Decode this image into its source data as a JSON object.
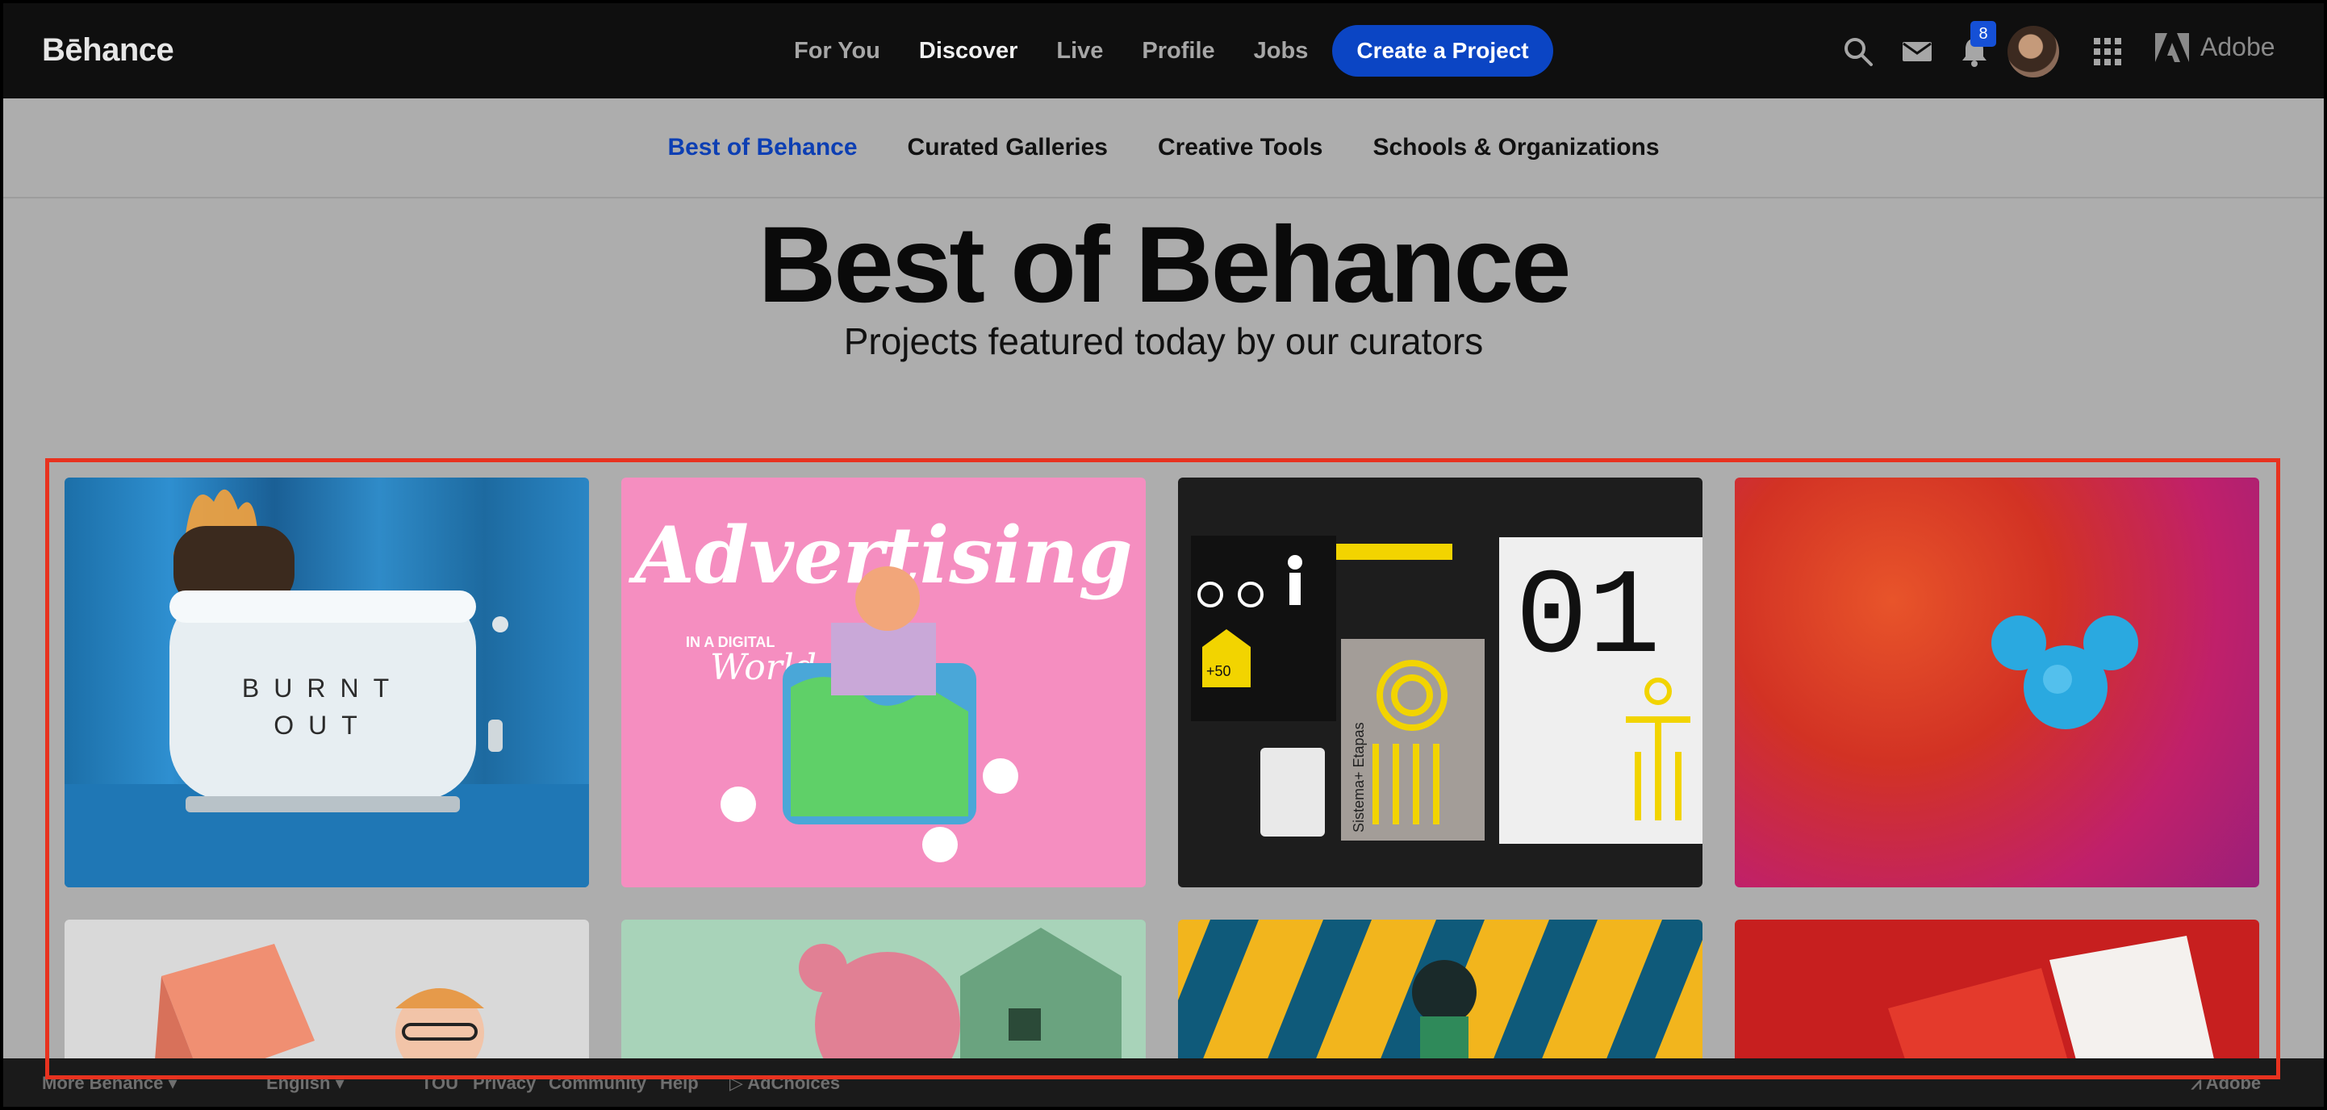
{
  "topnav": {
    "logo": "Bēhance",
    "links": [
      "For You",
      "Discover",
      "Live",
      "Profile",
      "Jobs"
    ],
    "active": "Discover",
    "create_label": "Create a Project",
    "notification_count": "8",
    "adobe_label": "Adobe"
  },
  "subnav": {
    "items": [
      "Best of Behance",
      "Curated Galleries",
      "Creative Tools",
      "Schools & Organizations"
    ],
    "active": "Best of Behance"
  },
  "hero": {
    "title": "Best of Behance",
    "subtitle": "Projects featured today by our curators"
  },
  "cards": {
    "toaster_text_1": "BURNT",
    "toaster_text_2": "OUT",
    "advertising_title": "Advertising",
    "advertising_sub_1": "IN A DIGITAL",
    "advertising_sub_2": "World",
    "etapas_number": "01",
    "etapas_plus": "+50",
    "etapas_vertical": "Sistema+ Etapas"
  },
  "footer": {
    "more": "More Behance",
    "language": "English",
    "links": [
      "TOU",
      "Privacy",
      "Community",
      "Help"
    ],
    "adchoices": "AdChoices",
    "adobe": "Adobe"
  },
  "colors": {
    "accent_blue": "#0b45c4",
    "active_subnav": "#0d3fb3",
    "highlight_red": "#e8321f"
  }
}
